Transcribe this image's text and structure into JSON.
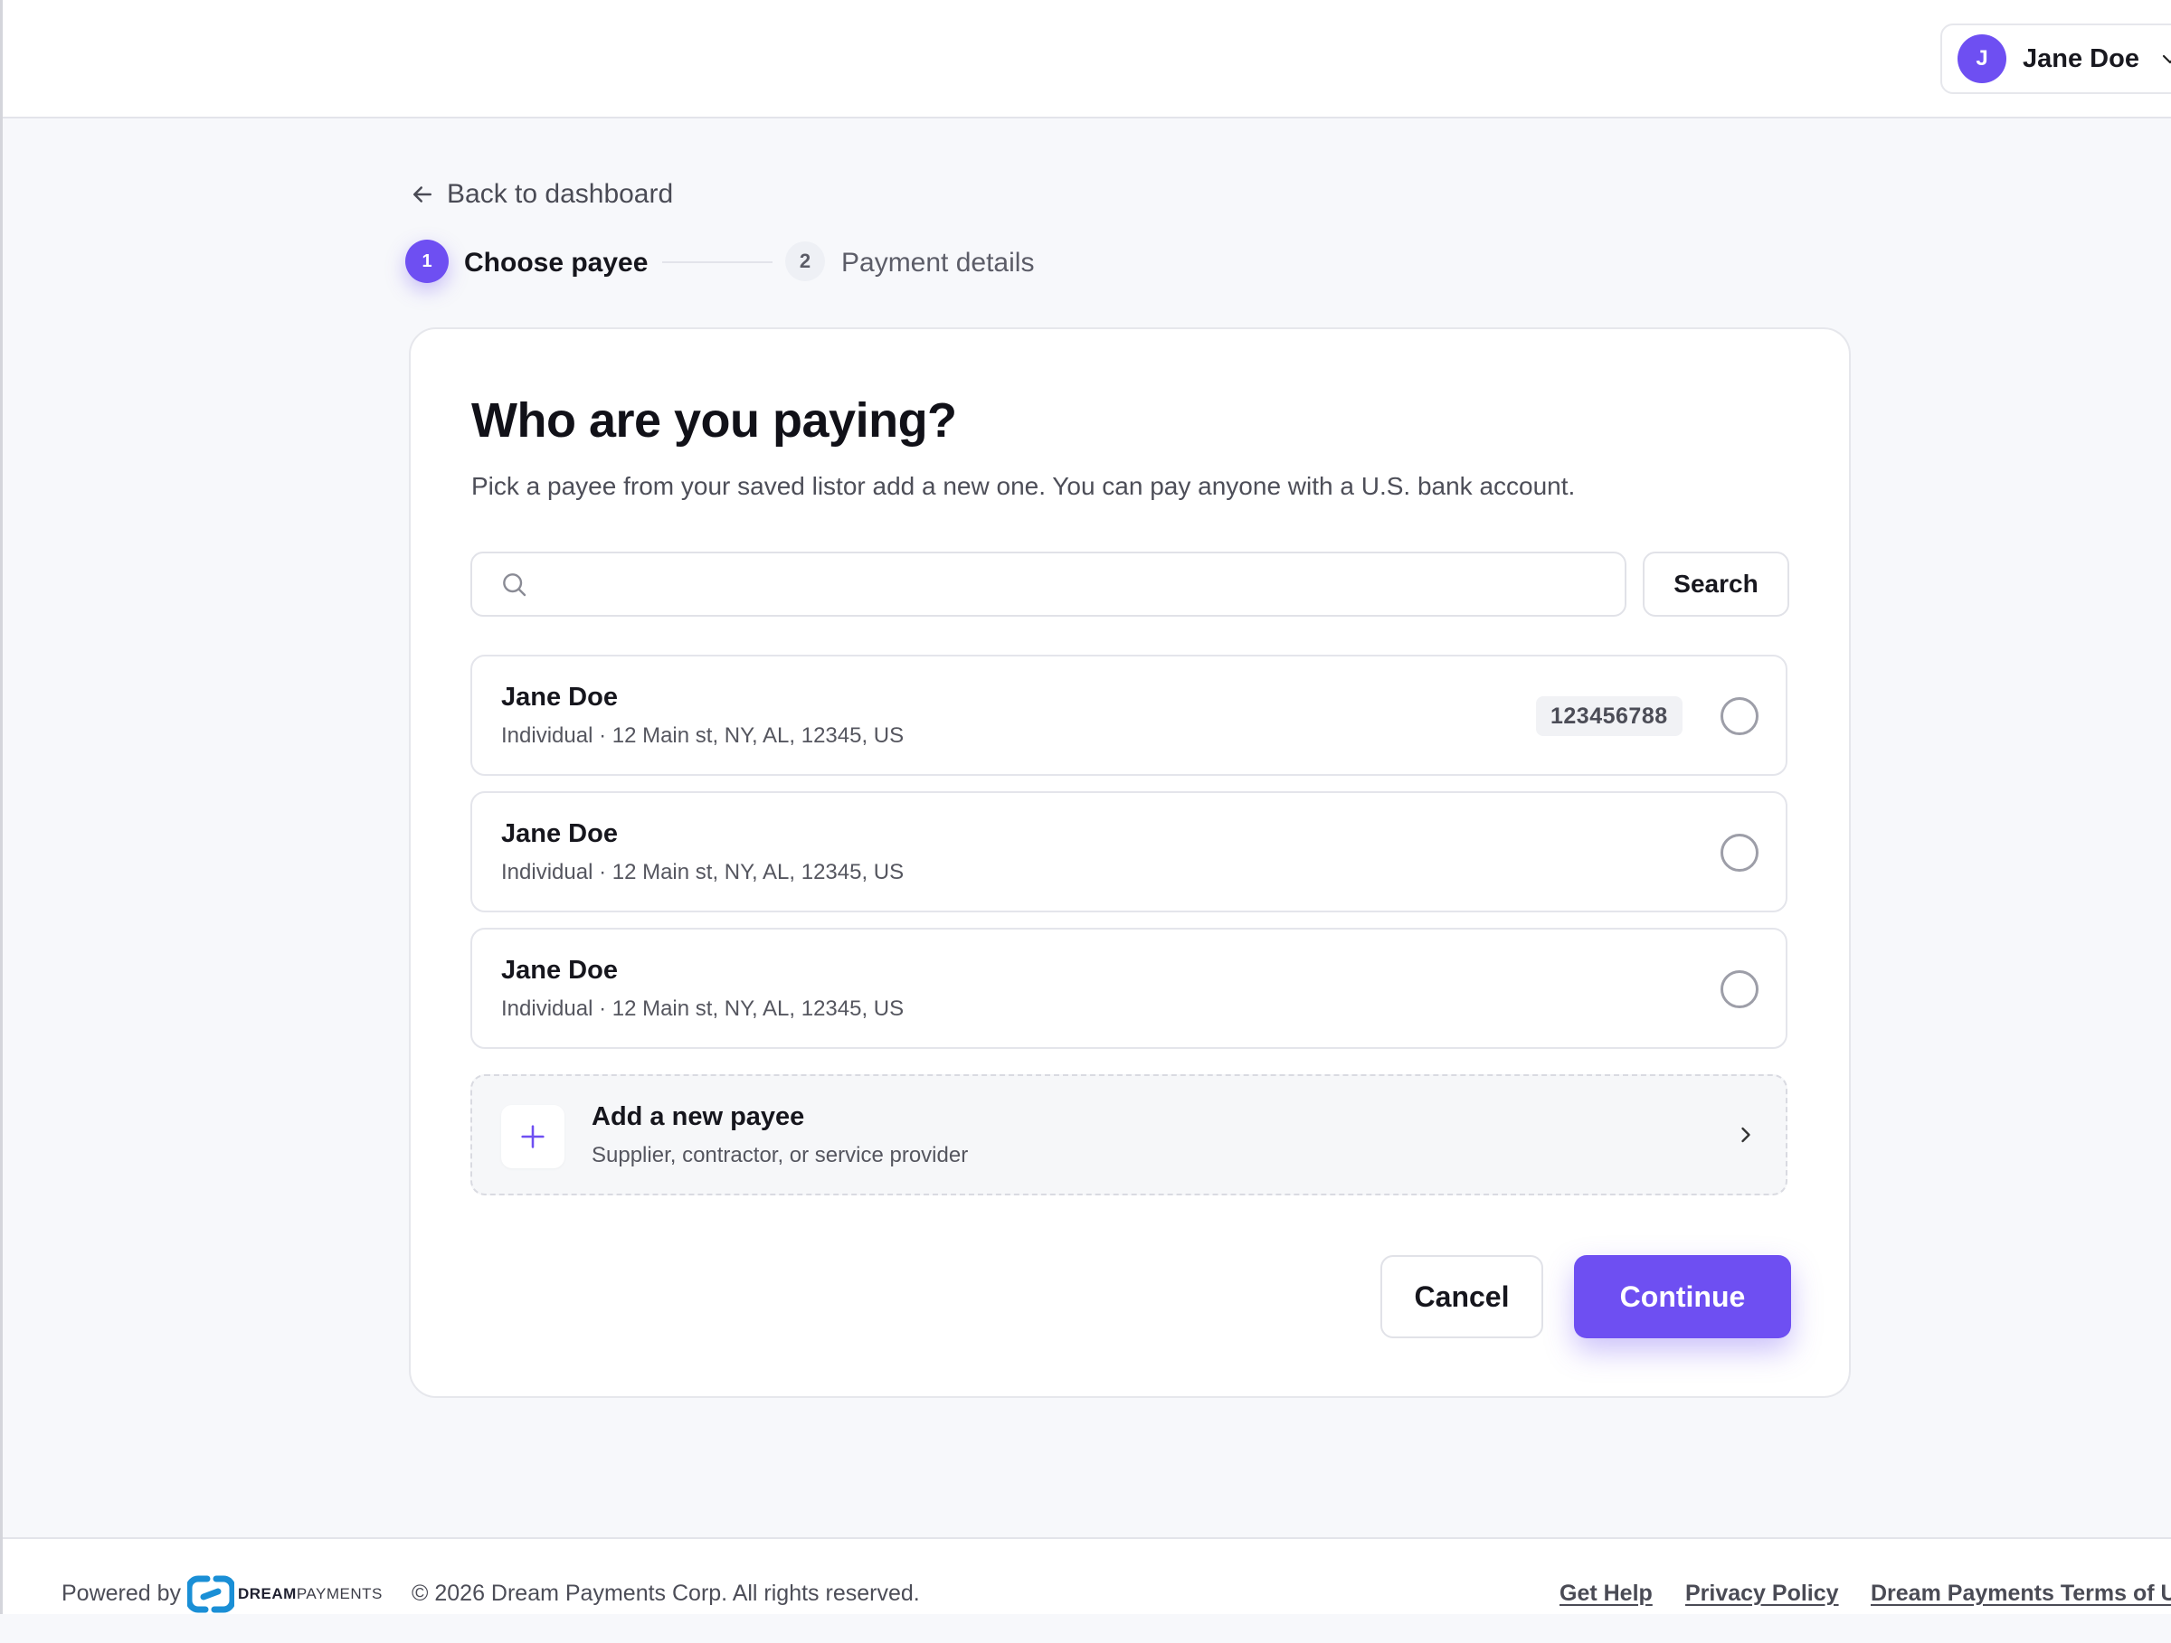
{
  "header": {
    "user": {
      "initial": "J",
      "name": "Jane Doe"
    }
  },
  "nav": {
    "back_label": "Back to dashboard"
  },
  "stepper": {
    "steps": [
      {
        "number": "1",
        "label": "Choose payee",
        "state": "active"
      },
      {
        "number": "2",
        "label": "Payment details",
        "state": "upcoming"
      }
    ]
  },
  "card": {
    "title": "Who are you paying?",
    "subtitle": "Pick a payee from your saved listor add a new one. You can pay anyone with a U.S. bank account.",
    "search": {
      "value": "",
      "placeholder": "",
      "button_label": "Search"
    },
    "payees": [
      {
        "name": "Jane Doe",
        "detail": "Individual · 12 Main st, NY, AL, 12345, US",
        "account": "123456788",
        "selected": false
      },
      {
        "name": "Jane Doe",
        "detail": "Individual · 12 Main st, NY, AL, 12345, US",
        "account": "",
        "selected": false
      },
      {
        "name": "Jane Doe",
        "detail": "Individual · 12 Main st, NY, AL, 12345, US",
        "account": "",
        "selected": false
      }
    ],
    "add_payee": {
      "title": "Add a new payee",
      "subtitle": "Supplier, contractor, or service provider",
      "icon": "plus-icon"
    },
    "actions": {
      "cancel_label": "Cancel",
      "continue_label": "Continue"
    }
  },
  "footer": {
    "powered_by": "Powered by",
    "brand": {
      "bold": "DREAM",
      "light": "PAYMENTS"
    },
    "copyright": "© 2026 Dream Payments Corp. All rights reserved.",
    "links": [
      "Get Help",
      "Privacy Policy",
      "Dream Payments Terms of U"
    ]
  },
  "colors": {
    "accent": "#6e4ff2",
    "page_background": "#f7f8fb",
    "card_background": "#ffffff",
    "brand_logo": "#1a8fd6"
  }
}
